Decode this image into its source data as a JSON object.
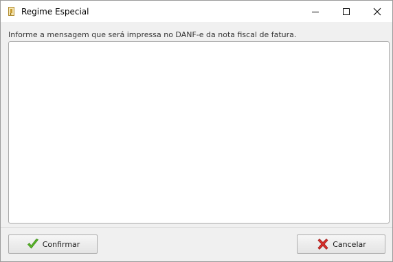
{
  "window": {
    "title": "Regime Especial",
    "icon": "document-key-icon",
    "controls": {
      "minimize": "minimize-icon",
      "maximize": "maximize-icon",
      "close": "close-icon"
    }
  },
  "form": {
    "prompt": "Informe a mensagem que será impressa no DANF-e da nota fiscal de fatura.",
    "message_value": ""
  },
  "buttons": {
    "confirm_label": "Confirmar",
    "confirm_icon": "checkmark-icon",
    "cancel_label": "Cancelar",
    "cancel_icon": "red-x-icon"
  },
  "colors": {
    "confirm_icon": "#5cb82a",
    "cancel_icon": "#d9302c",
    "close_hover": "#e81123"
  }
}
